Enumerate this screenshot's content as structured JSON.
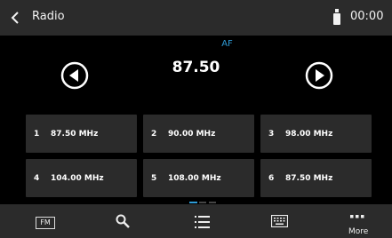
{
  "header": {
    "title": "Radio",
    "time": "00:00"
  },
  "tuner": {
    "af": "AF",
    "frequency": "87.50"
  },
  "presets": [
    {
      "num": "1",
      "freq": "87.50 MHz"
    },
    {
      "num": "2",
      "freq": "90.00 MHz"
    },
    {
      "num": "3",
      "freq": "98.00 MHz"
    },
    {
      "num": "4",
      "freq": "104.00 MHz"
    },
    {
      "num": "5",
      "freq": "108.00 MHz"
    },
    {
      "num": "6",
      "freq": "87.50 MHz"
    }
  ],
  "pager": {
    "current_page": 1,
    "total_pages": 3
  },
  "bottom": {
    "band_label": "FM",
    "more_label": "More"
  },
  "colors": {
    "accent": "#2f9bd6",
    "bar": "#2b2b2b",
    "tile": "#2b2b2b",
    "background": "#000000"
  }
}
